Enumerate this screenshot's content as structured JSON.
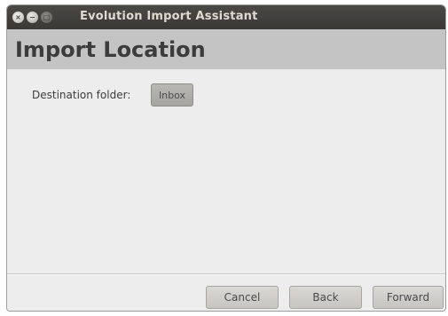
{
  "window": {
    "title": "Evolution Import Assistant",
    "controls": {
      "close_icon": "×",
      "minimize_icon": "−",
      "maximize_icon": "□"
    }
  },
  "page": {
    "heading": "Import Location"
  },
  "destination": {
    "label": "Destination folder:",
    "value": "Inbox"
  },
  "footer": {
    "cancel_label": "Cancel",
    "back_label": "Back",
    "forward_label": "Forward"
  },
  "colors": {
    "titlebar": "#3c3b37",
    "header": "#c4c4c4",
    "background": "#ededed"
  }
}
